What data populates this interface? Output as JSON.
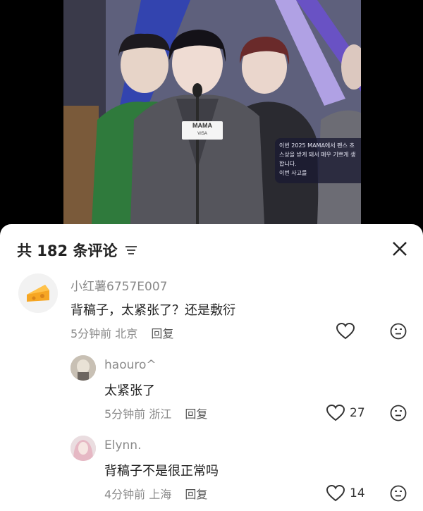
{
  "video": {
    "subtitle_lines": [
      "이번 2025 MAMA에서 팬스 초",
      "스상을 받게 돼서 매우 기쁘게 생",
      "합니다.",
      "이번 사고를"
    ],
    "badge_logo": "MAMA",
    "badge_sponsor": "VISA"
  },
  "comments_sheet": {
    "title": "共 182 条评论",
    "filter_icon": "filter-lines-icon",
    "close_icon": "close-x-icon"
  },
  "comments": [
    {
      "username": "小红薯6757E007",
      "text": "背稿子，太紧张了？还是敷衍",
      "time": "5分钟前",
      "location": "北京",
      "reply_label": "回复",
      "likes": ""
    },
    {
      "username": "haouro^",
      "text": "太紧张了",
      "time": "5分钟前",
      "location": "浙江",
      "reply_label": "回复",
      "likes": "27"
    },
    {
      "username": "Elynn.",
      "text": "背稿子不是很正常吗",
      "time": "4分钟前",
      "location": "上海",
      "reply_label": "回复",
      "likes": "14"
    }
  ],
  "colors": {
    "accent_text": "#222222",
    "muted_text": "#8a8a8a",
    "sheet_bg": "#ffffff"
  }
}
